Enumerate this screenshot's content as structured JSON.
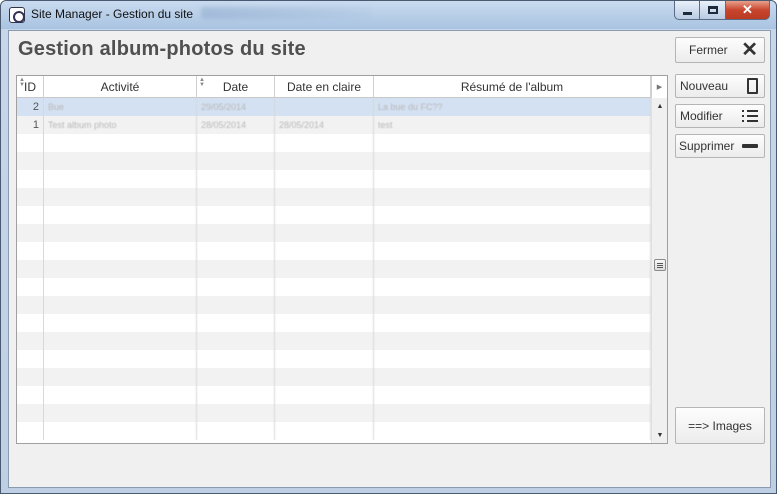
{
  "window": {
    "title": "Site Manager - Gestion du site",
    "close_glyph": "✕"
  },
  "page": {
    "title": "Gestion album-photos du site"
  },
  "grid": {
    "columns": [
      "ID",
      "Activité",
      "Date",
      "Date en claire",
      "Résumé de l'album"
    ],
    "rows": [
      {
        "id": "2",
        "activite": "Bue",
        "date": "29/05/2014",
        "date_claire": "",
        "resume": "La bue du FC??"
      },
      {
        "id": "1",
        "activite": "Test album photo",
        "date": "28/05/2014",
        "date_claire": "28/05/2014",
        "resume": "test"
      }
    ],
    "selected_row": 0
  },
  "buttons": {
    "fermer": "Fermer",
    "nouveau": "Nouveau",
    "modifier": "Modifier",
    "supprimer": "Supprimer",
    "images": "==> Images"
  },
  "icons": {
    "app": "app-icon",
    "close": "close-icon",
    "new": "document-icon",
    "edit": "list-edit-icon",
    "delete": "minus-icon"
  },
  "colors": {
    "selected_row": "#d4e1f2",
    "title_text": "#505050"
  }
}
